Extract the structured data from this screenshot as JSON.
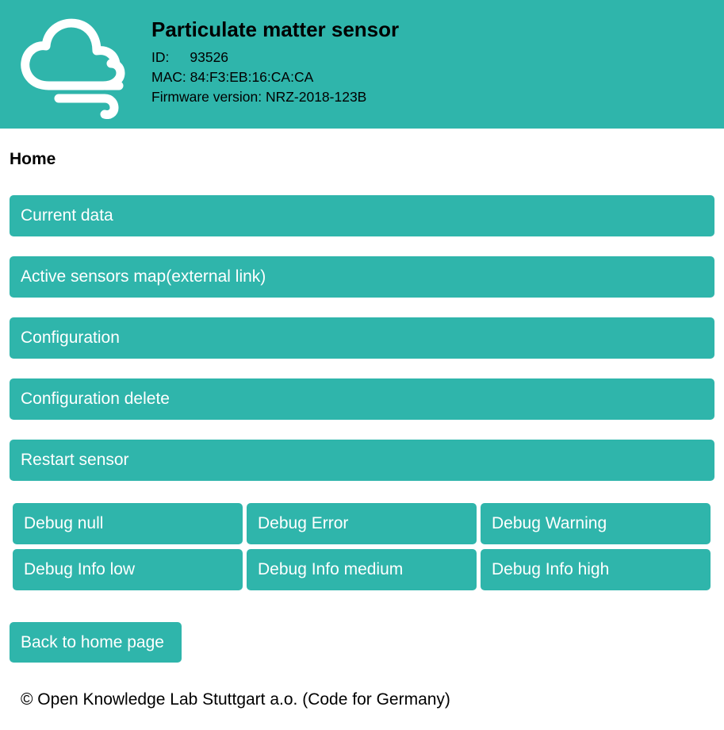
{
  "header": {
    "logo_icon": "cloud-wind-icon",
    "title": "Particulate matter sensor",
    "id_label": "ID:",
    "id_value": "93526",
    "mac_label": "MAC:",
    "mac_value": "84:F3:EB:16:CA:CA",
    "firmware_label": "Firmware version:",
    "firmware_value": "NRZ-2018-123B",
    "background_color": "#2fb5ab"
  },
  "page": {
    "title": "Home"
  },
  "menu": {
    "current_data": "Current data",
    "sensors_map": "Active sensors map(external link)",
    "configuration": "Configuration",
    "configuration_delete": "Configuration delete",
    "restart": "Restart sensor"
  },
  "debug": {
    "null": "Debug null",
    "error": "Debug Error",
    "warning": "Debug Warning",
    "info_low": "Debug Info low",
    "info_medium": "Debug Info medium",
    "info_high": "Debug Info high"
  },
  "back_button": "Back to home page",
  "footer": "© Open Knowledge Lab Stuttgart a.o. (Code for Germany)",
  "colors": {
    "accent": "#2fb5ab",
    "button_text": "#ffffff"
  }
}
